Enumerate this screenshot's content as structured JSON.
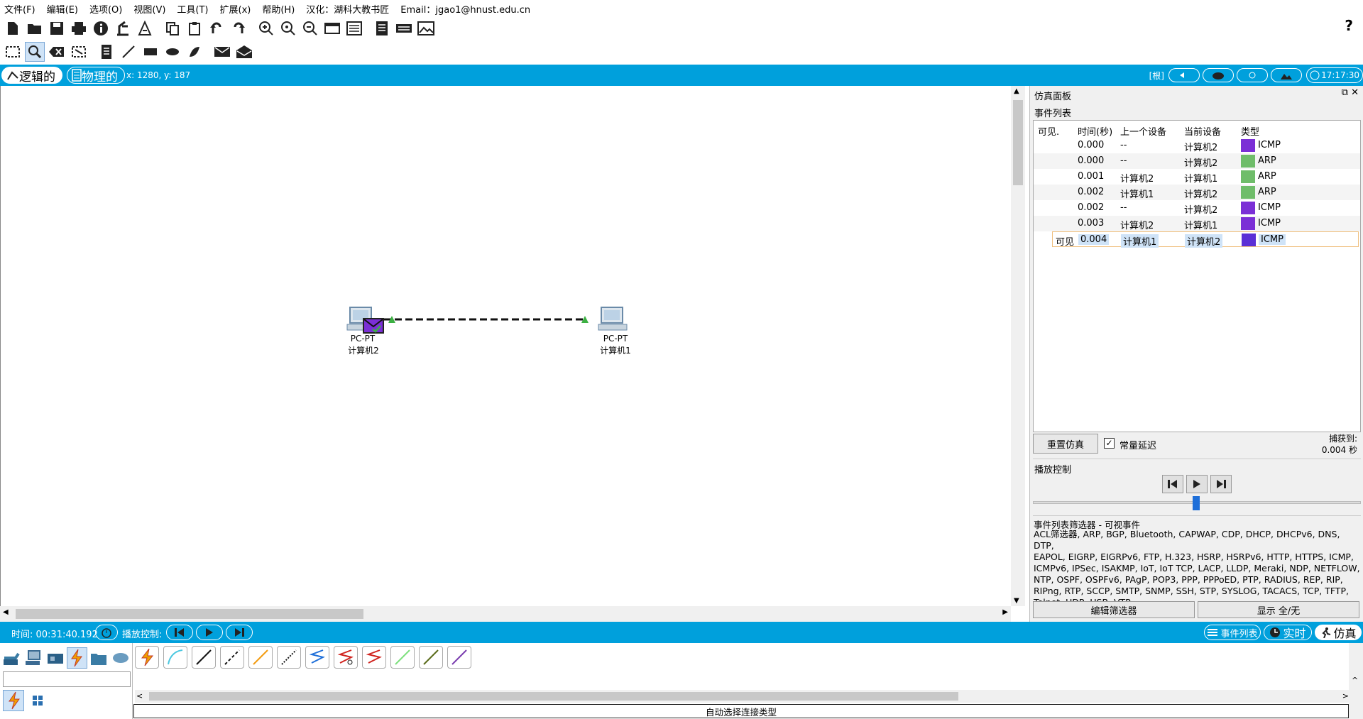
{
  "menu": [
    "文件(F)",
    "编辑(E)",
    "选项(O)",
    "视图(V)",
    "工具(T)",
    "扩展(x)",
    "帮助(H)",
    "汉化：湖科大教书匠",
    "Email：jgao1@hnust.edu.cn"
  ],
  "help_label": "?",
  "view_tabs": {
    "logical": "逻辑的",
    "physical": "物理的"
  },
  "coords": "x: 1280, y: 187",
  "top_right": {
    "root": "[根]",
    "clock": "17:17:30"
  },
  "devices": [
    {
      "type": "PC-PT",
      "name": "计算机2"
    },
    {
      "type": "PC-PT",
      "name": "计算机1"
    }
  ],
  "panel": {
    "title": "仿真面板",
    "event_list_label": "事件列表",
    "headers": [
      "可见.",
      "时间(秒)",
      "上一个设备",
      "当前设备",
      "类型"
    ],
    "events": [
      {
        "visible": "",
        "time": "0.000",
        "prev": "--",
        "curr": "计算机2",
        "type": "ICMP",
        "color": "#7b2fd6"
      },
      {
        "visible": "",
        "time": "0.000",
        "prev": "--",
        "curr": "计算机2",
        "type": "ARP",
        "color": "#6fbd6a"
      },
      {
        "visible": "",
        "time": "0.001",
        "prev": "计算机2",
        "curr": "计算机1",
        "type": "ARP",
        "color": "#6fbd6a"
      },
      {
        "visible": "",
        "time": "0.002",
        "prev": "计算机1",
        "curr": "计算机2",
        "type": "ARP",
        "color": "#6fbd6a"
      },
      {
        "visible": "",
        "time": "0.002",
        "prev": "--",
        "curr": "计算机2",
        "type": "ICMP",
        "color": "#7b2fd6"
      },
      {
        "visible": "",
        "time": "0.003",
        "prev": "计算机2",
        "curr": "计算机1",
        "type": "ICMP",
        "color": "#7b2fd6"
      },
      {
        "visible": "可见",
        "time": "0.004",
        "prev": "计算机1",
        "curr": "计算机2",
        "type": "ICMP",
        "color": "#5a2fd6"
      }
    ],
    "reset_btn": "重置仿真",
    "constant_delay": "常量延迟",
    "captured_label": "捕获到:",
    "captured_value": "0.004 秒",
    "playback_label": "播放控制",
    "filter_title": "事件列表筛选器 - 可视事件",
    "filter_lines": [
      "ACL筛选器, ARP, BGP, Bluetooth, CAPWAP, CDP, DHCP, DHCPv6, DNS, DTP,",
      "EAPOL, EIGRP, EIGRPv6, FTP, H.323, HSRP, HSRPv6, HTTP, HTTPS, ICMP,",
      "ICMPv6, IPSec, ISAKMP, IoT, IoT TCP, LACP, LLDP, Meraki, NDP, NETFLOW,",
      "NTP, OSPF, OSPFv6, PAgP, POP3, PPP, PPPoED, PTP, RADIUS, REP, RIP,",
      "RIPng, RTP, SCCP, SMTP, SNMP, SSH, STP, SYSLOG, TACACS, TCP, TFTP,",
      "Telnet, UDP, USB, VTP"
    ],
    "edit_filter_btn": "编辑筛选器",
    "show_all_btn": "显示 全/无"
  },
  "bottom": {
    "time_label": "时间: 00:31:40.192",
    "playback_label": "播放控制:",
    "event_list_btn": "事件列表",
    "realtime_btn": "实时",
    "simulation_btn": "仿真"
  },
  "auto_connection": "自动选择连接类型",
  "colors": {
    "accent": "#00a0dc",
    "icmp": "#7b2fd6",
    "arp": "#6fbd6a"
  }
}
